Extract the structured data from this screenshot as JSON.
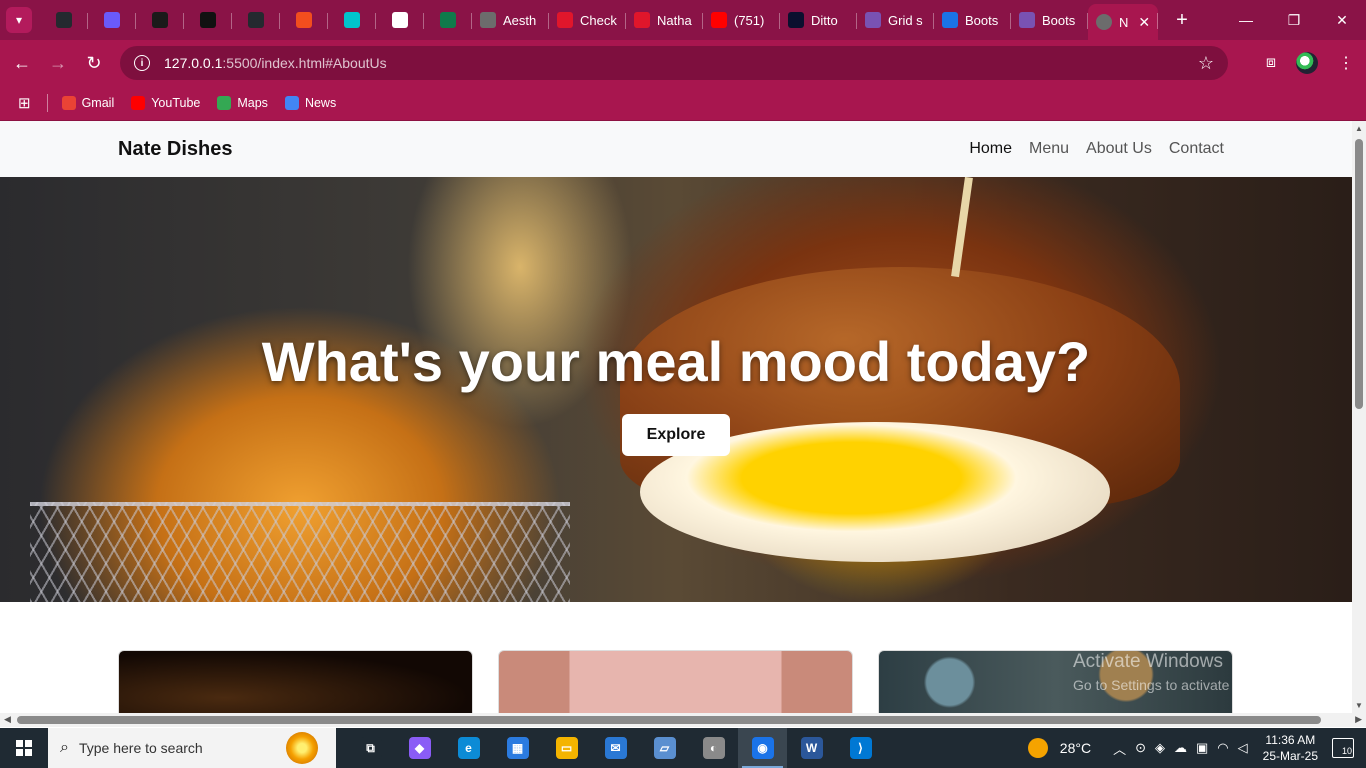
{
  "browser": {
    "tabs": [
      {
        "label": "",
        "icon": "github-icon",
        "color": "#24292f"
      },
      {
        "label": "",
        "icon": "play-icon",
        "color": "#6a5af9"
      },
      {
        "label": "",
        "icon": "media-icon",
        "color": "#1a1a1a"
      },
      {
        "label": "",
        "icon": "openai-icon",
        "color": "#111111"
      },
      {
        "label": "",
        "icon": "github-icon",
        "color": "#24292f"
      },
      {
        "label": "",
        "icon": "figma-icon",
        "color": "#f24e1e"
      },
      {
        "label": "",
        "icon": "canva-icon",
        "color": "#00c4cc"
      },
      {
        "label": "",
        "icon": "wave-icon",
        "color": "#ffffff"
      },
      {
        "label": "",
        "icon": "w-icon",
        "color": "#0f7a4b"
      },
      {
        "label": "Aesth",
        "icon": "globe-icon",
        "color": "#6c6c6c"
      },
      {
        "label": "Check",
        "icon": "opera-icon",
        "color": "#e0162b"
      },
      {
        "label": "Natha",
        "icon": "opera-icon",
        "color": "#e0162b"
      },
      {
        "label": "(751)",
        "icon": "youtube-icon",
        "color": "#ff0000"
      },
      {
        "label": "Ditto",
        "icon": "ditto-icon",
        "color": "#0b0f2e"
      },
      {
        "label": "Grid s",
        "icon": "bootstrap-icon",
        "color": "#7952b3"
      },
      {
        "label": "Boots",
        "icon": "bolt-icon",
        "color": "#1a73e8"
      },
      {
        "label": "Boots",
        "icon": "bootstrap-icon",
        "color": "#7952b3"
      }
    ],
    "active_tab": {
      "label": "N",
      "icon": "globe-icon",
      "close": "✕"
    },
    "new_tab": "+",
    "window_controls": {
      "minimize": "—",
      "maximize": "❐",
      "close": "✕"
    },
    "url_host": "127.0.0.1",
    "url_path": ":5500/index.html#AboutUs",
    "bookmarks": [
      {
        "label": "Gmail",
        "icon": "gmail-icon",
        "color": "#ea4335"
      },
      {
        "label": "YouTube",
        "icon": "youtube-icon",
        "color": "#ff0000"
      },
      {
        "label": "Maps",
        "icon": "maps-icon",
        "color": "#34a853"
      },
      {
        "label": "News",
        "icon": "news-icon",
        "color": "#4285f4"
      }
    ]
  },
  "page": {
    "brand": "Nate Dishes",
    "nav": [
      "Home",
      "Menu",
      "About Us",
      "Contact"
    ],
    "hero_title": "What's your meal mood today?",
    "hero_button": "Explore",
    "watermark_title": "Activate Windows",
    "watermark_sub": "Go to Settings to activate Windows."
  },
  "taskbar": {
    "search_placeholder": "Type here to search",
    "apps": [
      {
        "icon": "task-view-icon",
        "glyph": "⧉",
        "color": "#1f2a33"
      },
      {
        "icon": "copilot-icon",
        "glyph": "◆",
        "color": "#8a5cf6"
      },
      {
        "icon": "edge-icon",
        "glyph": "e",
        "color": "#0c8bd6"
      },
      {
        "icon": "store-icon",
        "glyph": "▦",
        "color": "#2b7be0"
      },
      {
        "icon": "file-explorer-icon",
        "glyph": "▭",
        "color": "#f4b400"
      },
      {
        "icon": "mail-icon",
        "glyph": "✉",
        "color": "#2a78d4"
      },
      {
        "icon": "laptop-icon",
        "glyph": "▱",
        "color": "#5a8fd0"
      },
      {
        "icon": "media-player-icon",
        "glyph": "◐",
        "color": "#8a8a8a"
      },
      {
        "icon": "chrome-icon",
        "glyph": "◉",
        "color": "#1a73e8"
      },
      {
        "icon": "word-icon",
        "glyph": "W",
        "color": "#2b579a"
      },
      {
        "icon": "vscode-icon",
        "glyph": "⟩",
        "color": "#0078d4"
      }
    ],
    "temperature": "28°C",
    "time": "11:36 AM",
    "date": "25-Mar-25",
    "notifications": "10"
  }
}
